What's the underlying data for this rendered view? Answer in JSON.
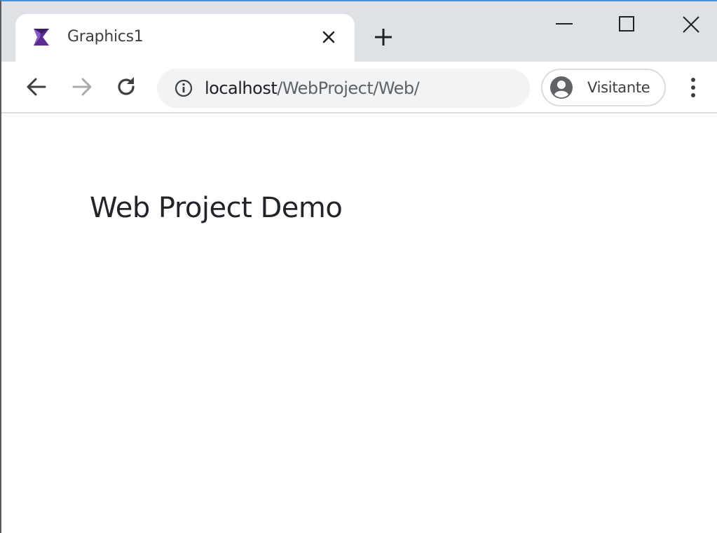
{
  "browser": {
    "tab": {
      "title": "Graphics1",
      "favicon": "hourglass-logo-icon"
    },
    "window_controls": [
      "minimize-icon",
      "maximize-icon",
      "close-icon"
    ],
    "address_bar": {
      "host": "localhost",
      "path": "/WebProject/Web/",
      "security_icon": "info-icon"
    },
    "profile": {
      "label": "Visitante",
      "icon": "account-circle-icon"
    },
    "colors": {
      "tabstrip": "#dee1e6",
      "omnibox": "#f1f3f4",
      "favicon": "#5c2d91"
    }
  },
  "page": {
    "heading": "Web Project Demo"
  }
}
